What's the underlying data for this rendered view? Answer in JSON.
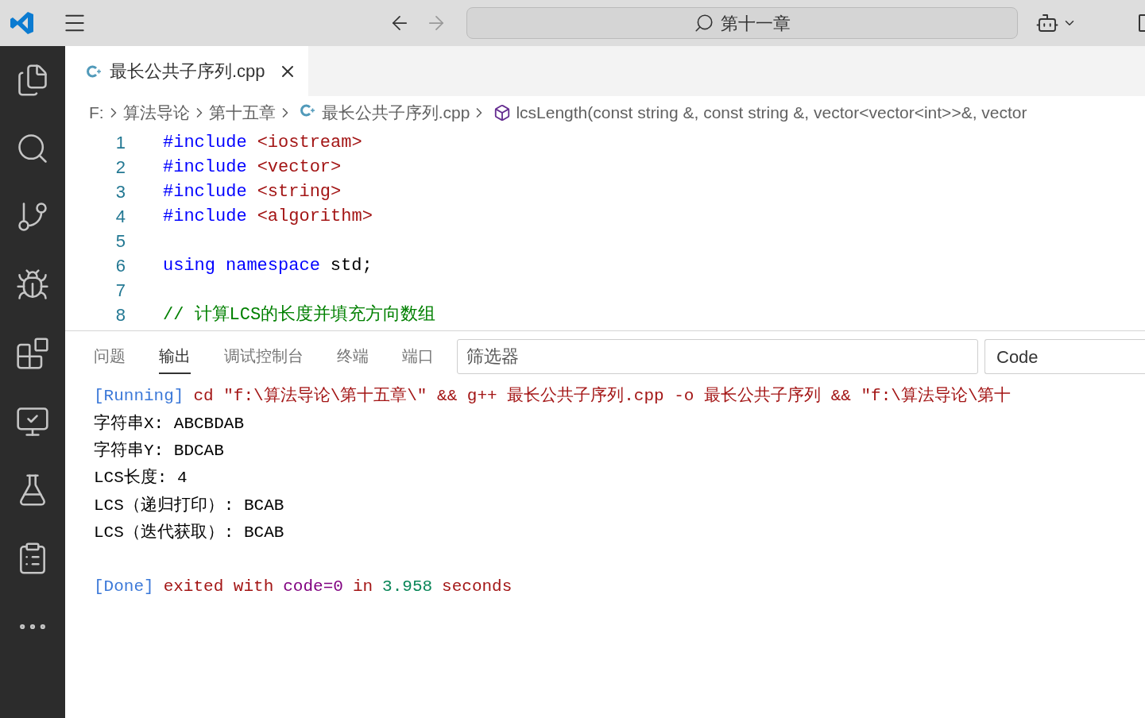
{
  "title_bar": {
    "search": "第十一章"
  },
  "editor_tabs": [
    {
      "label": "最长公共子序列.cpp",
      "selected": true
    }
  ],
  "breadcrumb": [
    {
      "kind": "text",
      "label": "F:"
    },
    {
      "kind": "text",
      "label": "算法导论"
    },
    {
      "kind": "text",
      "label": "第十五章"
    },
    {
      "kind": "file",
      "label": "最长公共子序列.cpp"
    },
    {
      "kind": "symbol",
      "label": "lcsLength(const string &, const string &, vector<vector<int>>&, vector"
    }
  ],
  "code_lines": [
    {
      "number": "1",
      "tokens": [
        {
          "kind": "keyword",
          "text": "#include"
        },
        {
          "kind": "string",
          "text": "<iostream>"
        }
      ]
    },
    {
      "number": "2",
      "tokens": [
        {
          "kind": "keyword",
          "text": "#include"
        },
        {
          "kind": "string",
          "text": "<vector>"
        }
      ]
    },
    {
      "number": "3",
      "tokens": [
        {
          "kind": "keyword",
          "text": "#include"
        },
        {
          "kind": "string",
          "text": "<string>"
        }
      ]
    },
    {
      "number": "4",
      "tokens": [
        {
          "kind": "keyword",
          "text": "#include"
        },
        {
          "kind": "string",
          "text": "<algorithm>"
        }
      ]
    },
    {
      "number": "5"
    },
    {
      "number": "6",
      "tokens": [
        {
          "kind": "keyword",
          "text": "using"
        },
        {
          "kind": "keyword",
          "text": "namespace"
        },
        {
          "kind": "plain",
          "text": "std;"
        }
      ]
    },
    {
      "number": "7"
    },
    {
      "number": "8",
      "tokens": [
        {
          "kind": "comment",
          "text": "// 计算LCS的长度并填充方向数组"
        }
      ]
    }
  ],
  "panel": {
    "tabs": [
      {
        "label": "问题",
        "selected": false
      },
      {
        "label": "输出",
        "selected": true
      },
      {
        "label": "调试控制台",
        "selected": false
      },
      {
        "label": "终端",
        "selected": false
      },
      {
        "label": "端口",
        "selected": false
      }
    ],
    "filter": {
      "placeholder": "筛选器"
    },
    "channel": "Code",
    "output": [
      {
        "kind": "text",
        "segments": [
          {
            "kind": "tag",
            "text": "[Running]"
          },
          {
            "kind": "error",
            "text": "cd \"f:\\算法导论\\第十五章\\\" && g++ 最长公共子序列.cpp -o 最长公共子序列 && \"f:\\算法导论\\第十"
          }
        ]
      },
      {
        "kind": "text",
        "segments": [
          {
            "kind": "plain",
            "text": "字符串X: ABCBDAB"
          }
        ]
      },
      {
        "kind": "text",
        "segments": [
          {
            "kind": "plain",
            "text": "字符串Y: BDCAB"
          }
        ]
      },
      {
        "kind": "text",
        "segments": [
          {
            "kind": "plain",
            "text": "LCS长度: 4"
          }
        ]
      },
      {
        "kind": "text",
        "segments": [
          {
            "kind": "plain",
            "text": "LCS（递归打印）: BCAB"
          }
        ]
      },
      {
        "kind": "text",
        "segments": [
          {
            "kind": "plain",
            "text": "LCS（迭代获取）: BCAB"
          }
        ]
      },
      {
        "kind": "blank"
      },
      {
        "kind": "text",
        "segments": [
          {
            "kind": "tag",
            "text": "[Done]"
          },
          {
            "kind": "error",
            "text": "exited with"
          },
          {
            "kind": "code",
            "text": "code=0"
          },
          {
            "kind": "error",
            "text": "in"
          },
          {
            "kind": "number",
            "text": "3.958"
          },
          {
            "kind": "error",
            "text": "seconds"
          }
        ]
      }
    ]
  }
}
